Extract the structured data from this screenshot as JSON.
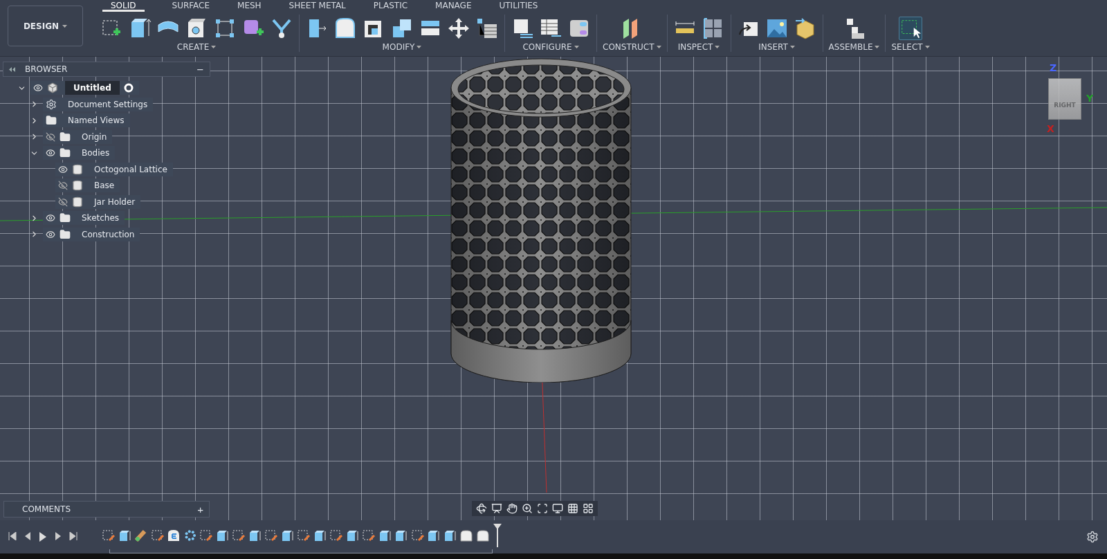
{
  "workspace": {
    "label": "DESIGN"
  },
  "tabs": [
    {
      "label": "SOLID",
      "selected": true
    },
    {
      "label": "SURFACE",
      "selected": false
    },
    {
      "label": "MESH",
      "selected": false
    },
    {
      "label": "SHEET METAL",
      "selected": false
    },
    {
      "label": "PLASTIC",
      "selected": false
    },
    {
      "label": "MANAGE",
      "selected": false
    },
    {
      "label": "UTILITIES",
      "selected": false
    }
  ],
  "tool_groups": [
    {
      "label": "CREATE"
    },
    {
      "label": "MODIFY"
    },
    {
      "label": "CONFIGURE"
    },
    {
      "label": "CONSTRUCT"
    },
    {
      "label": "INSPECT"
    },
    {
      "label": "INSERT"
    },
    {
      "label": "ASSEMBLE"
    },
    {
      "label": "SELECT"
    }
  ],
  "browser": {
    "title": "BROWSER",
    "collapse": "−",
    "tree": [
      {
        "label": "Untitled",
        "kind": "document",
        "visible": true,
        "expanded": true,
        "children": [
          {
            "label": "Document Settings",
            "kind": "settings",
            "expanded": false
          },
          {
            "label": "Named Views",
            "kind": "folder",
            "expanded": false
          },
          {
            "label": "Origin",
            "kind": "folder",
            "visible": false,
            "expanded": false
          },
          {
            "label": "Bodies",
            "kind": "folder",
            "visible": true,
            "expanded": true,
            "children": [
              {
                "label": "Octogonal Lattice",
                "kind": "body",
                "visible": true
              },
              {
                "label": "Base",
                "kind": "body",
                "visible": false
              },
              {
                "label": "Jar Holder",
                "kind": "body",
                "visible": false
              }
            ]
          },
          {
            "label": "Sketches",
            "kind": "folder",
            "visible": true,
            "expanded": false
          },
          {
            "label": "Construction",
            "kind": "folder",
            "visible": true,
            "expanded": false
          }
        ]
      }
    ]
  },
  "viewcube": {
    "face": "RIGHT",
    "axes": [
      {
        "label": "Z",
        "color": "#4a66ff"
      },
      {
        "label": "Y",
        "color": "#22a02a"
      },
      {
        "label": "X",
        "color": "#c42020"
      }
    ]
  },
  "comments": {
    "title": "COMMENTS",
    "add": "+"
  },
  "timeline": {
    "features": [
      {
        "kind": "sketch"
      },
      {
        "kind": "extrude"
      },
      {
        "kind": "sweep"
      },
      {
        "kind": "sketch"
      },
      {
        "kind": "emboss"
      },
      {
        "kind": "pattern"
      },
      {
        "kind": "sketch"
      },
      {
        "kind": "extrude"
      },
      {
        "kind": "sketch"
      },
      {
        "kind": "extrude"
      },
      {
        "kind": "sketch"
      },
      {
        "kind": "extrude"
      },
      {
        "kind": "sketch"
      },
      {
        "kind": "extrude"
      },
      {
        "kind": "sketch"
      },
      {
        "kind": "extrude"
      },
      {
        "kind": "sketch"
      },
      {
        "kind": "extrude"
      },
      {
        "kind": "extrude"
      },
      {
        "kind": "sketch"
      },
      {
        "kind": "extrude"
      },
      {
        "kind": "extrude"
      },
      {
        "kind": "fillet"
      },
      {
        "kind": "fillet"
      }
    ]
  }
}
